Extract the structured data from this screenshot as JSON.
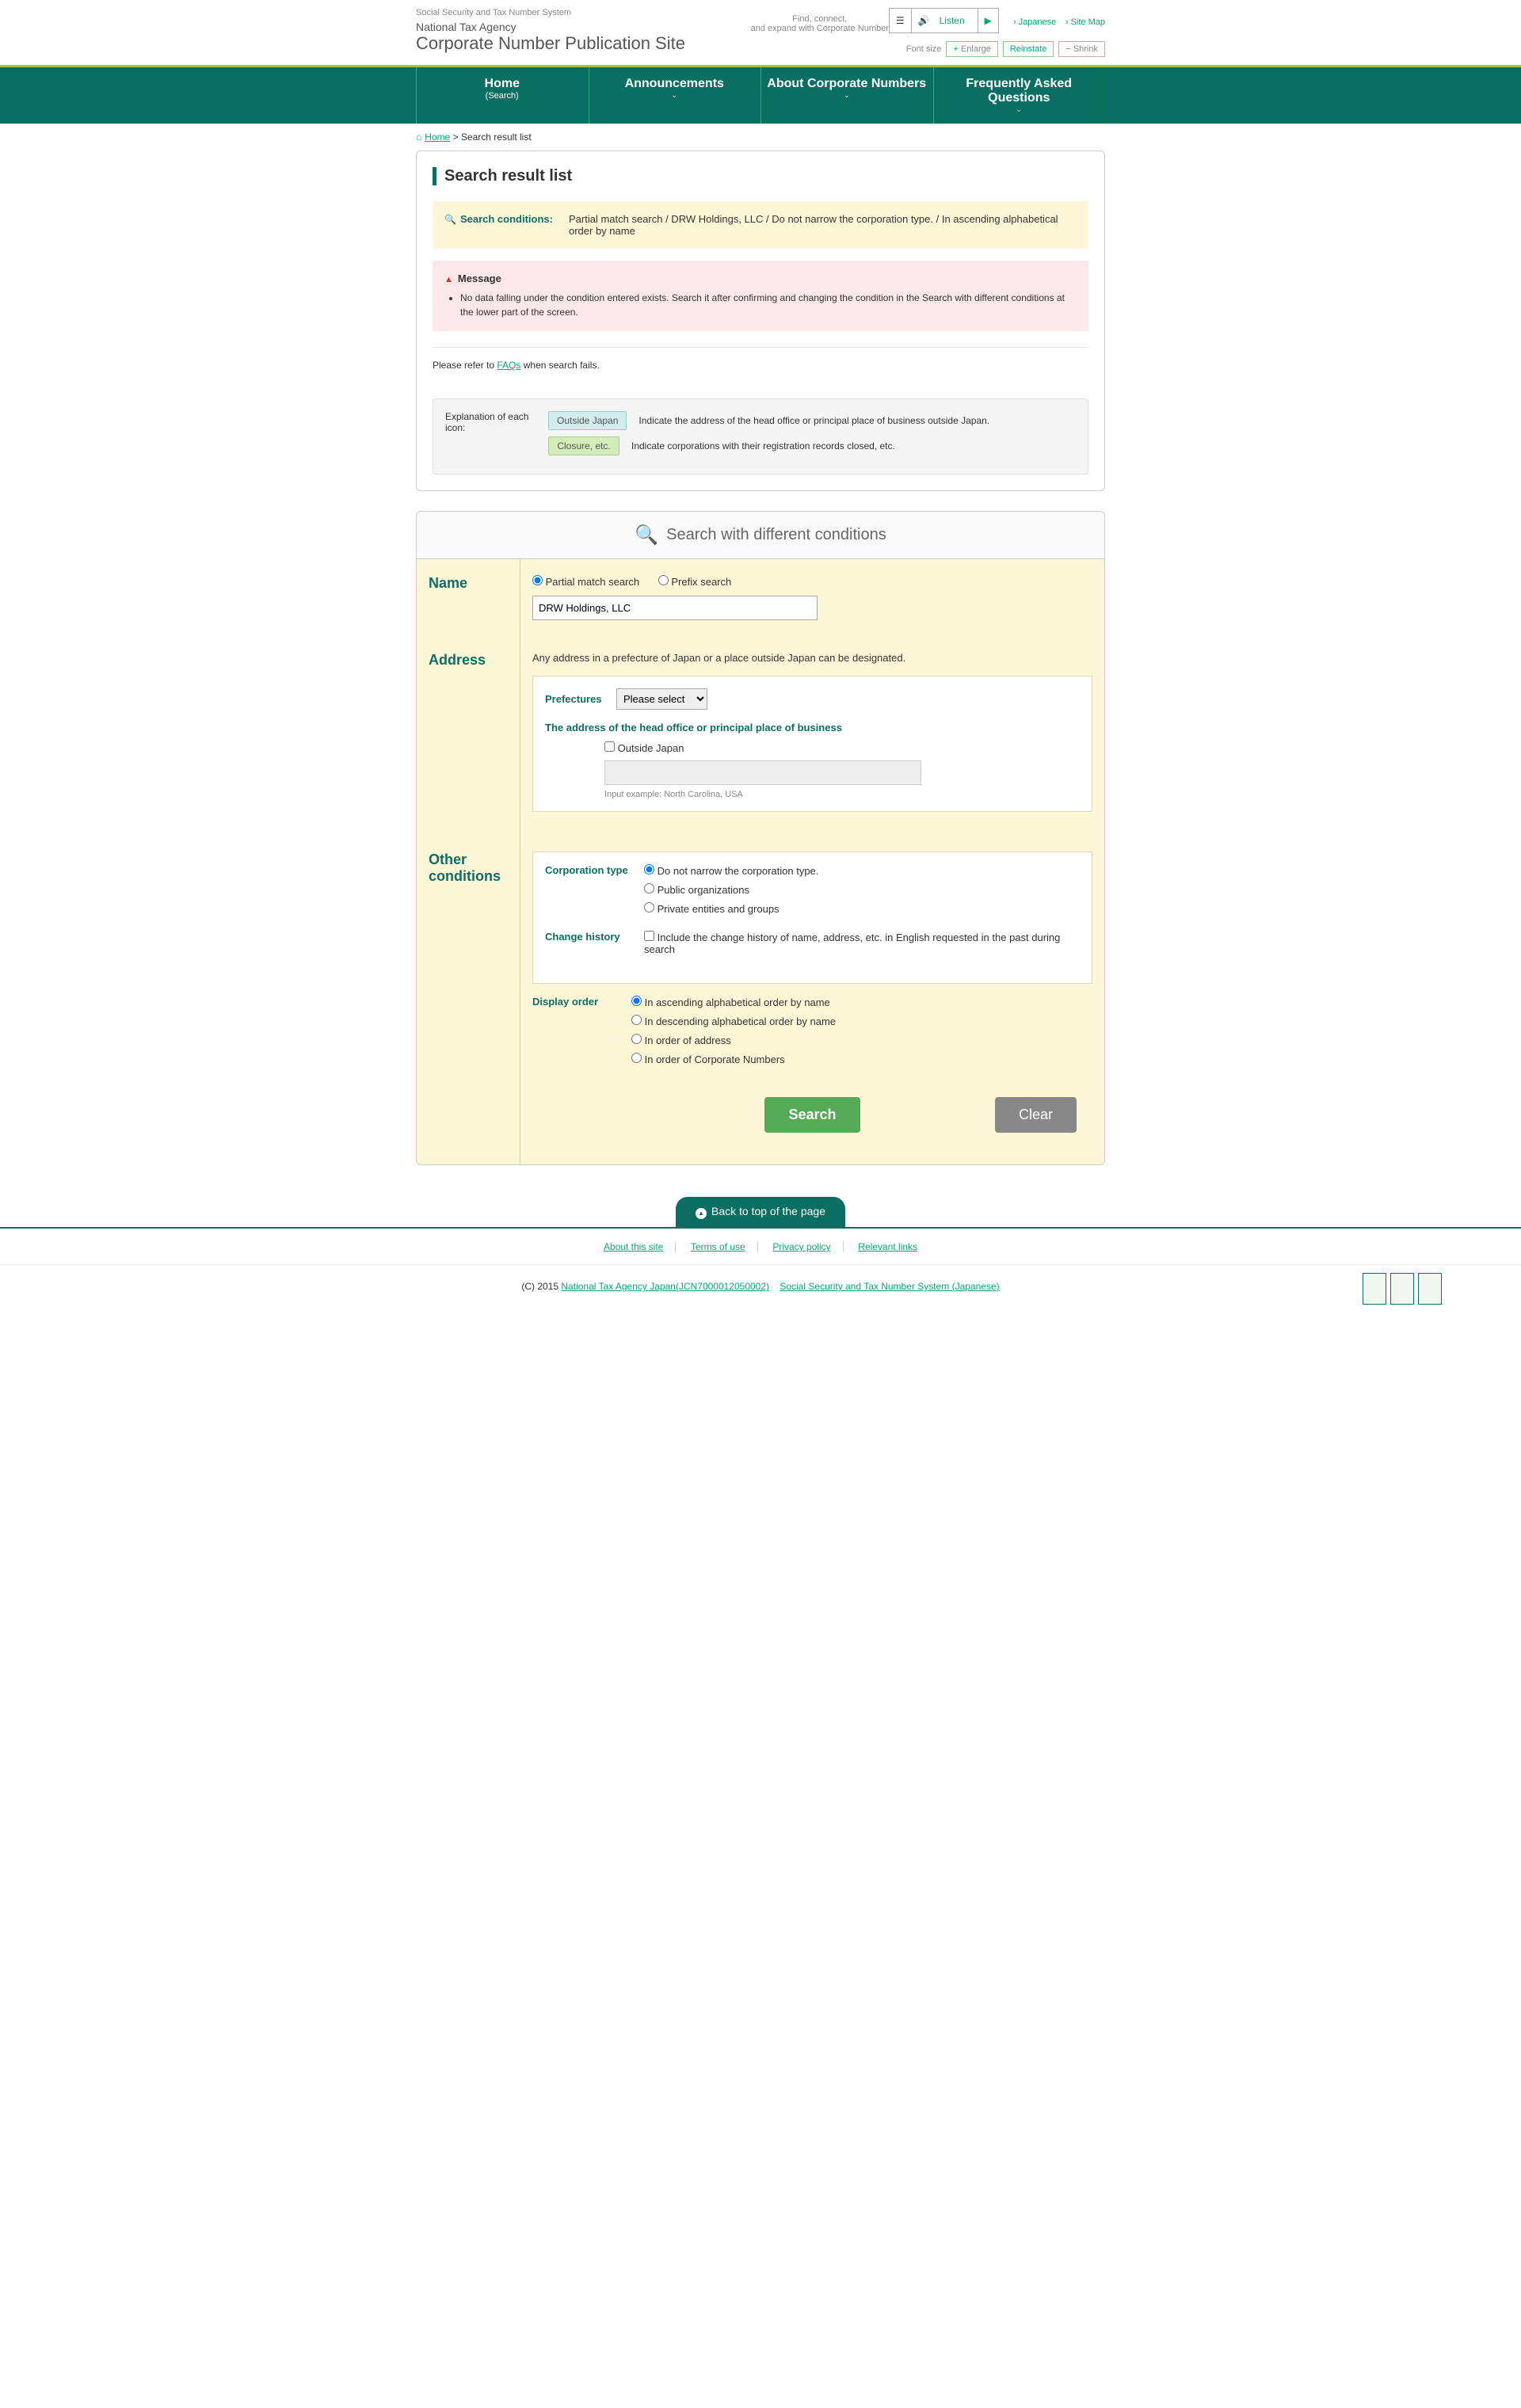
{
  "header": {
    "tagline": "Social Security and Tax Number System",
    "agency": "National Tax Agency",
    "site_title": "Corporate Number Publication Site",
    "slogan_line1": "Find, connect,",
    "slogan_line2": "and expand with Corporate Number",
    "listen": "Listen",
    "util_links": {
      "japanese": "Japanese",
      "sitemap": "Site Map"
    },
    "font_label": "Font size",
    "font_buttons": {
      "enlarge": "Enlarge",
      "reinstate": "Reinstate",
      "shrink": "Shrink"
    }
  },
  "nav": {
    "home": {
      "title": "Home",
      "sub": "(Search)"
    },
    "announcements": "Announcements",
    "about": "About Corporate Numbers",
    "faq": "Frequently Asked Questions"
  },
  "breadcrumb": {
    "home": "Home",
    "sep": " > ",
    "current": "Search result list"
  },
  "results": {
    "title": "Search result list",
    "cond_label": "Search conditions:",
    "cond_text": "Partial match search / DRW Holdings, LLC / Do not narrow the corporation type. / In ascending alphabetical order by name",
    "msg_title": "Message",
    "msg_text": "No data falling under the condition entered exists. Search it after confirming and changing the condition in the Search with different conditions at the lower part of the screen.",
    "faq_note_pre": "Please refer to ",
    "faq_link": "FAQs",
    "faq_note_post": " when search fails.",
    "icon_label": "Explanation of each icon:",
    "badge_outside": "Outside Japan",
    "badge_outside_desc": "Indicate the address of the head office or principal place of business outside Japan.",
    "badge_closure": "Closure, etc.",
    "badge_closure_desc": "Indicate corporations with their registration records closed, etc."
  },
  "search": {
    "header": "Search with different conditions",
    "name_label": "Name",
    "partial": "Partial match search",
    "prefix": "Prefix search",
    "name_value": "DRW Holdings, LLC",
    "addr_label": "Address",
    "addr_note": "Any address in a prefecture of Japan or a place outside Japan can be designated.",
    "pref_label": "Prefectures",
    "pref_placeholder": "Please select",
    "sub_head": "The address of the head office or principal place of business",
    "outside_cb": "Outside Japan",
    "hint": "Input example: North Carolina, USA",
    "other_label": "Other conditions",
    "corp_type_label": "Corporation type",
    "corp_opts": [
      "Do not narrow the corporation type.",
      "Public organizations",
      "Private entities and groups"
    ],
    "change_label": "Change history",
    "change_text": "Include the change history of name, address, etc. in English requested in the past during search",
    "display_label": "Display order",
    "display_opts": [
      "In ascending alphabetical order by name",
      "In descending alphabetical order by name",
      "In order of address",
      "In order of Corporate Numbers"
    ],
    "btn_search": "Search",
    "btn_clear": "Clear"
  },
  "footer": {
    "back_top": "Back to top of the page",
    "links": [
      "About this site",
      "Terms of use",
      "Privacy policy",
      "Relevant links"
    ],
    "copy_pre": "(C) 2015 ",
    "copy_link1": "National Tax Agency Japan(JCN7000012050002)",
    "copy_link2": "Social Security and Tax Number System (Japanese)"
  }
}
